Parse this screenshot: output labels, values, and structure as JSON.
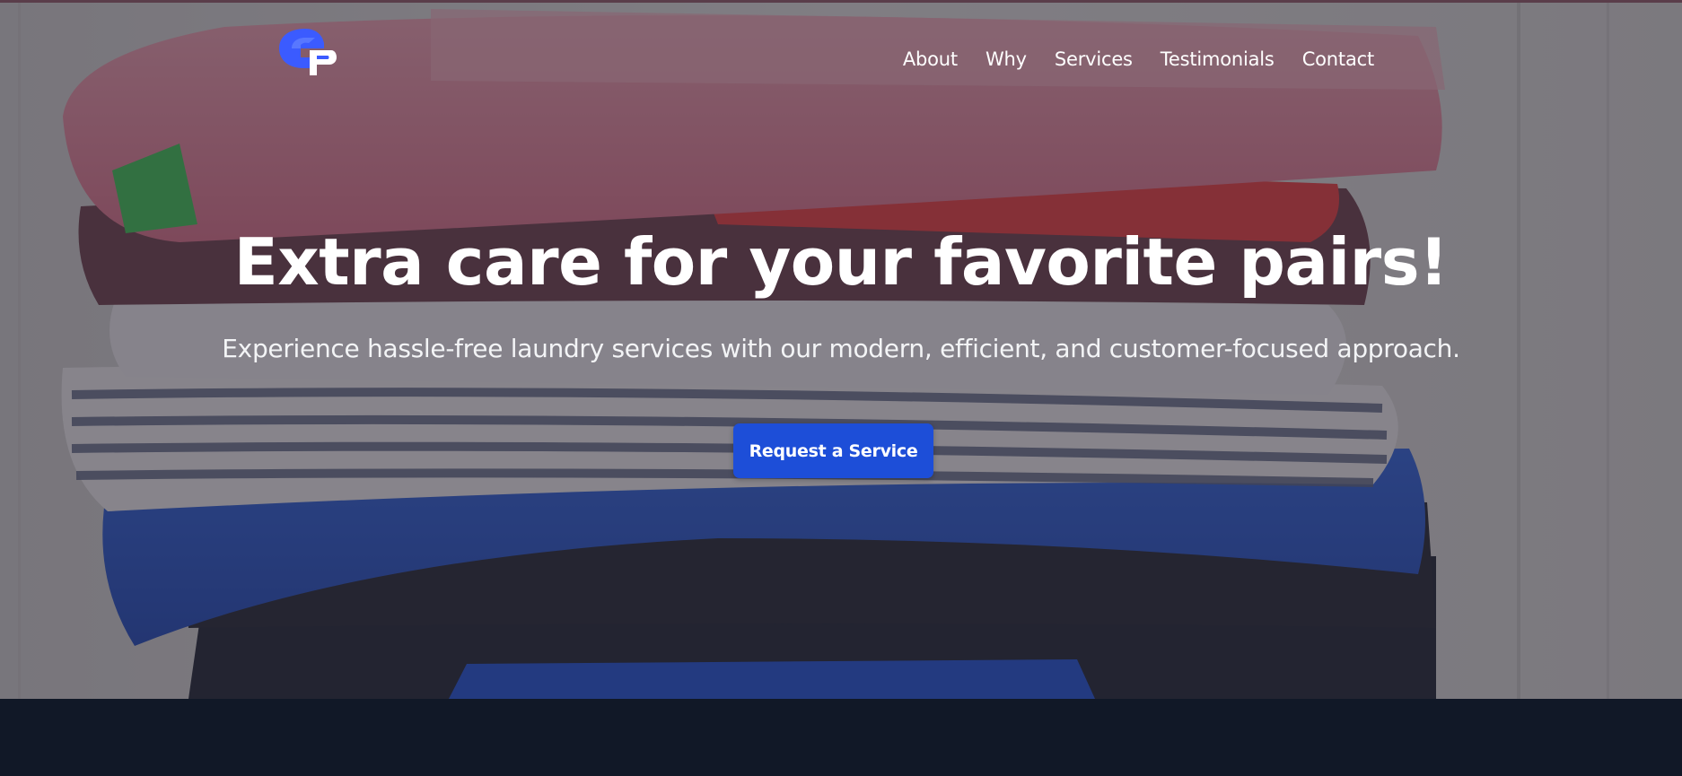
{
  "colors": {
    "accent": "#1d4ed8",
    "logo_blue": "#3b5bff",
    "dark_band": "#111827",
    "text_light": "#ffffff"
  },
  "brand": {
    "logo_icon": "gp-monogram-logo"
  },
  "nav": {
    "items": [
      {
        "label": "About"
      },
      {
        "label": "Why"
      },
      {
        "label": "Services"
      },
      {
        "label": "Testimonials"
      },
      {
        "label": "Contact"
      }
    ]
  },
  "hero": {
    "title": "Extra care for your favorite pairs!",
    "subtitle": "Experience hassle-free laundry services with our modern, efficient, and customer-focused approach.",
    "cta_label": "Request a Service",
    "background_image": "stack-of-folded-clothes-photo"
  }
}
